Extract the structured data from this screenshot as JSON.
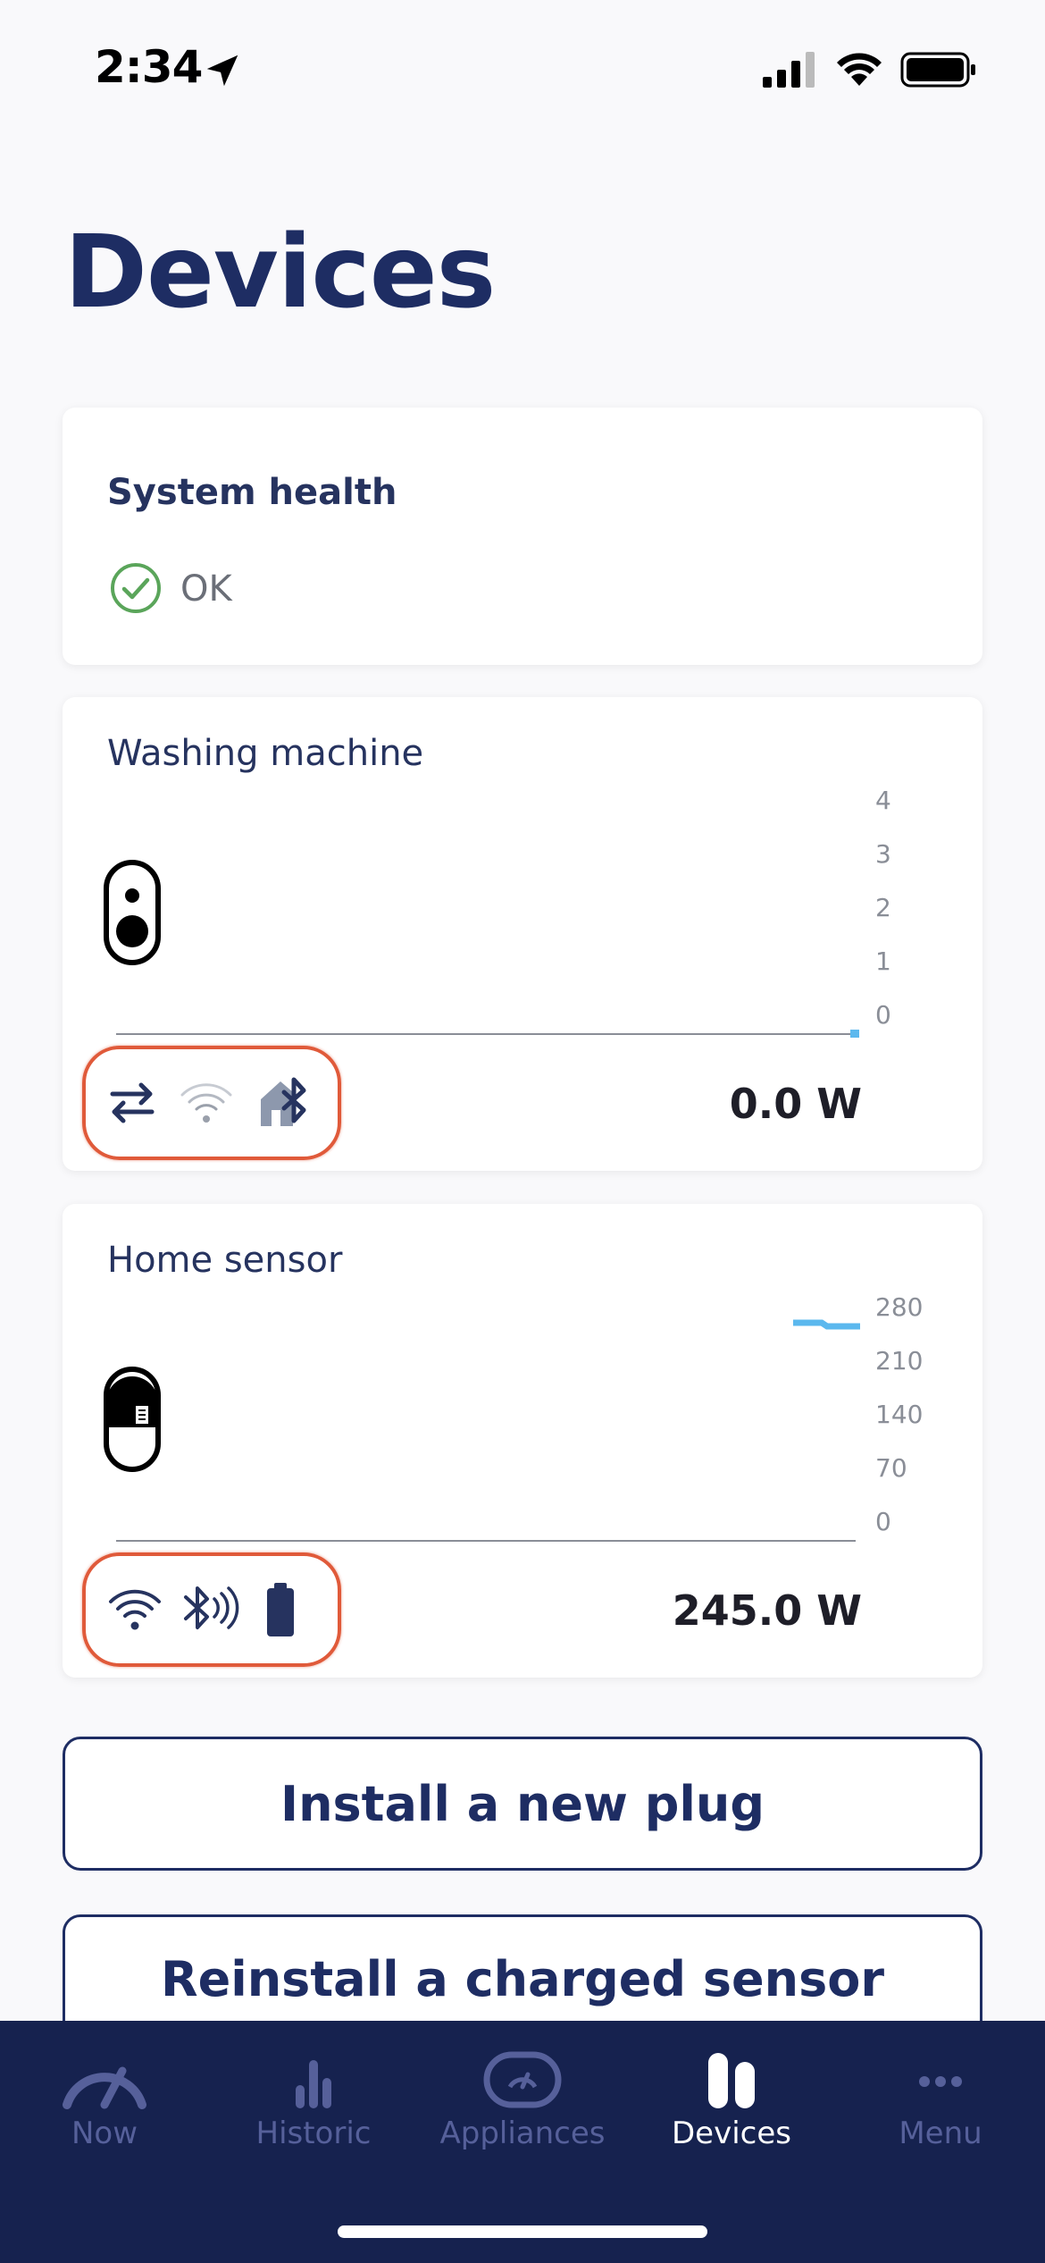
{
  "status_bar": {
    "time": "2:34"
  },
  "page": {
    "title": "Devices"
  },
  "system_health": {
    "title": "System health",
    "status": "OK",
    "status_color": "#5aa55a"
  },
  "devices": [
    {
      "name": "Washing machine",
      "power": "0.0 W",
      "y_ticks": [
        "4",
        "3",
        "2",
        "1",
        "0"
      ],
      "connectivity_icons": [
        "transfer-arrows-icon",
        "wifi-weak-icon",
        "home-bluetooth-icon"
      ]
    },
    {
      "name": "Home sensor",
      "power": "245.0 W",
      "y_ticks": [
        "280",
        "210",
        "140",
        "70",
        "0"
      ],
      "connectivity_icons": [
        "wifi-icon",
        "bluetooth-signal-icon",
        "battery-icon"
      ]
    }
  ],
  "actions": {
    "install_label": "Install a new plug",
    "reinstall_label": "Reinstall a charged sensor"
  },
  "tabs": [
    {
      "label": "Now",
      "icon": "gauge-icon",
      "active": false
    },
    {
      "label": "Historic",
      "icon": "bar-chart-icon",
      "active": false
    },
    {
      "label": "Appliances",
      "icon": "appliance-icon",
      "active": false
    },
    {
      "label": "Devices",
      "icon": "devices-icon",
      "active": true
    },
    {
      "label": "Menu",
      "icon": "more-dots-icon",
      "active": false
    }
  ],
  "colors": {
    "brand_navy": "#1e2d63",
    "tab_bar": "#16224f",
    "chart_line": "#5bb8ee",
    "highlight": "#e05a3a"
  }
}
